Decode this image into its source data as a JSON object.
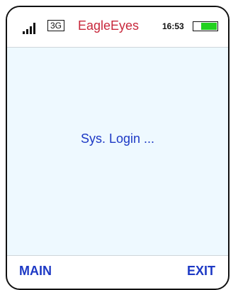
{
  "status_bar": {
    "network": "3G",
    "app_title": "EagleEyes",
    "time": "16:53",
    "battery_level": 0.7,
    "battery_color": "#22d11f"
  },
  "content": {
    "message": "Sys. Login ..."
  },
  "softkeys": {
    "left_label": "MAIN",
    "right_label": "EXIT"
  },
  "colors": {
    "title": "#c8283c",
    "text_blue": "#1d39c5",
    "screen_bg": "#eef9ff"
  },
  "icons": {
    "signal": "signal-strength-icon",
    "battery": "battery-icon"
  }
}
